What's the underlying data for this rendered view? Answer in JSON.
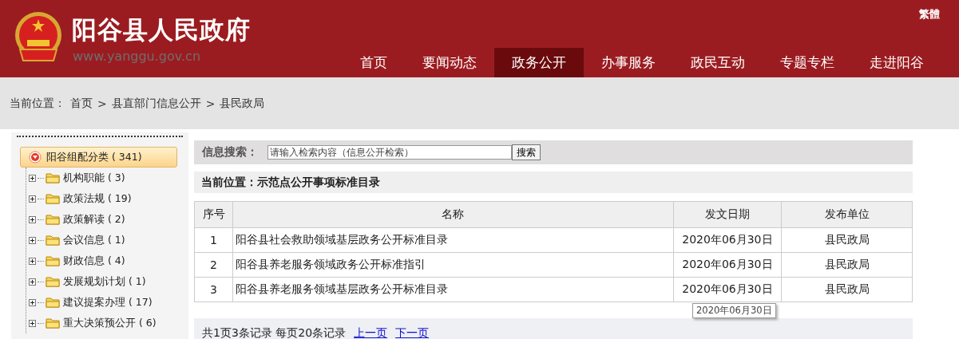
{
  "header": {
    "site_title": "阳谷县人民政府",
    "site_url": "www.yanggu.gov.cn",
    "language_link": "繁體"
  },
  "nav": [
    {
      "label": "首页",
      "selected": false
    },
    {
      "label": "要闻动态",
      "selected": false
    },
    {
      "label": "政务公开",
      "selected": true
    },
    {
      "label": "办事服务",
      "selected": false
    },
    {
      "label": "政民互动",
      "selected": false
    },
    {
      "label": "专题专栏",
      "selected": false
    },
    {
      "label": "走进阳谷",
      "selected": false
    }
  ],
  "breadcrumb": {
    "label": "当前位置：",
    "separator": ">",
    "items": [
      "首页",
      "县直部门信息公开",
      "县民政局"
    ]
  },
  "sidebar": {
    "label": "阳谷组配分类 ( 341)",
    "expanded": true,
    "children": [
      {
        "label": "机构职能 ( 3)",
        "expanded": false
      },
      {
        "label": "政策法规 ( 19)",
        "expanded": false
      },
      {
        "label": "政策解读 ( 2)",
        "expanded": false
      },
      {
        "label": "会议信息 ( 1)",
        "expanded": false
      },
      {
        "label": "财政信息 ( 4)",
        "expanded": false
      },
      {
        "label": "发展规划计划 ( 1)",
        "expanded": false
      },
      {
        "label": "建议提案办理 ( 17)",
        "expanded": false
      },
      {
        "label": "重大决策预公开 ( 6)",
        "expanded": false
      }
    ]
  },
  "search": {
    "label": "信息搜索：",
    "placeholder": "请输入检索内容（信息公开检索）",
    "button": "搜索"
  },
  "location": {
    "label": "当前位置：示范点公开事项标准目录"
  },
  "table": {
    "columns": [
      "序号",
      "名称",
      "发文日期",
      "发布单位"
    ],
    "rows": [
      [
        "1",
        "阳谷县社会救助领域基层政务公开标准目录",
        "2020年06月30日",
        "县民政局"
      ],
      [
        "2",
        "阳谷县养老服务领域政务公开标准指引",
        "2020年06月30日",
        "县民政局"
      ],
      [
        "3",
        "阳谷县养老服务领域基层政务公开标准目录",
        "2020年06月30日",
        "县民政局"
      ]
    ]
  },
  "tooltip": "2020年06月30日",
  "pagination": {
    "summary": "共1页3条记录 每页20条记录",
    "links": [
      "上一页",
      "下一页"
    ]
  }
}
